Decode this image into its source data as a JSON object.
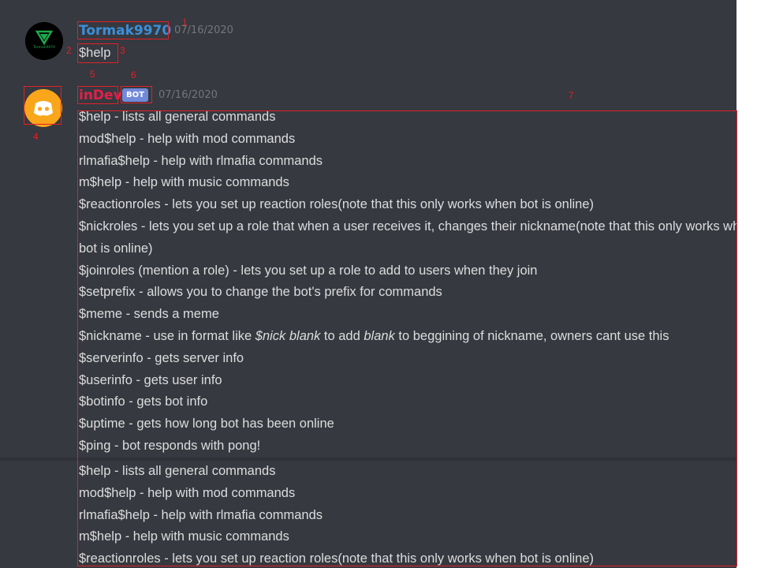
{
  "colors": {
    "background": "#36393f",
    "user_name": "#3b8fd9",
    "bot_name": "#e0214b",
    "bot_tag": "#7289da",
    "annotation": "#e0212b",
    "text": "#dcddde",
    "timestamp": "#72767d"
  },
  "msg1": {
    "avatar_text": "Tormak9970",
    "username": "Tormak9970",
    "timestamp": "07/16/2020",
    "content": "$help"
  },
  "msg2": {
    "username": "inDev",
    "bot_tag": "BOT",
    "timestamp": "07/16/2020",
    "lines": [
      "$help - lists all general commands",
      "mod$help - help with mod commands",
      "rlmafia$help - help with rlmafia commands",
      "m$help - help with music commands",
      "$reactionroles - lets you set up reaction roles(note that this only works when bot is online)",
      "$nickroles - lets you set up a role that when a user receives it, changes their nickname(note that this only works when",
      "bot is online)",
      "$joinroles (mention a role) - lets you set up a role to add to users when they join",
      "$setprefix - allows you to change the bot's prefix for commands",
      "$meme - sends a meme"
    ],
    "nickname_line": {
      "prefix": "$nickname - use in format like ",
      "italic1": "$nick blank",
      "middle": " to add ",
      "italic2": "blank",
      "suffix": " to beggining of nickname, owners cant use this"
    },
    "lines_after": [
      "$serverinfo - gets server info",
      "$userinfo - gets user info",
      "$botinfo - gets bot info",
      "$uptime - gets how long bot has been online",
      "$ping - bot responds with pong!"
    ],
    "repeat_lines": [
      "$help - lists all general commands",
      "mod$help - help with mod commands",
      "rlmafia$help - help with rlmafia commands",
      "m$help - help with music commands",
      "$reactionroles - lets you set up reaction roles(note that this only works when bot is online)"
    ]
  },
  "annotations": [
    "1",
    "2",
    "3",
    "4",
    "5",
    "6",
    "7"
  ]
}
